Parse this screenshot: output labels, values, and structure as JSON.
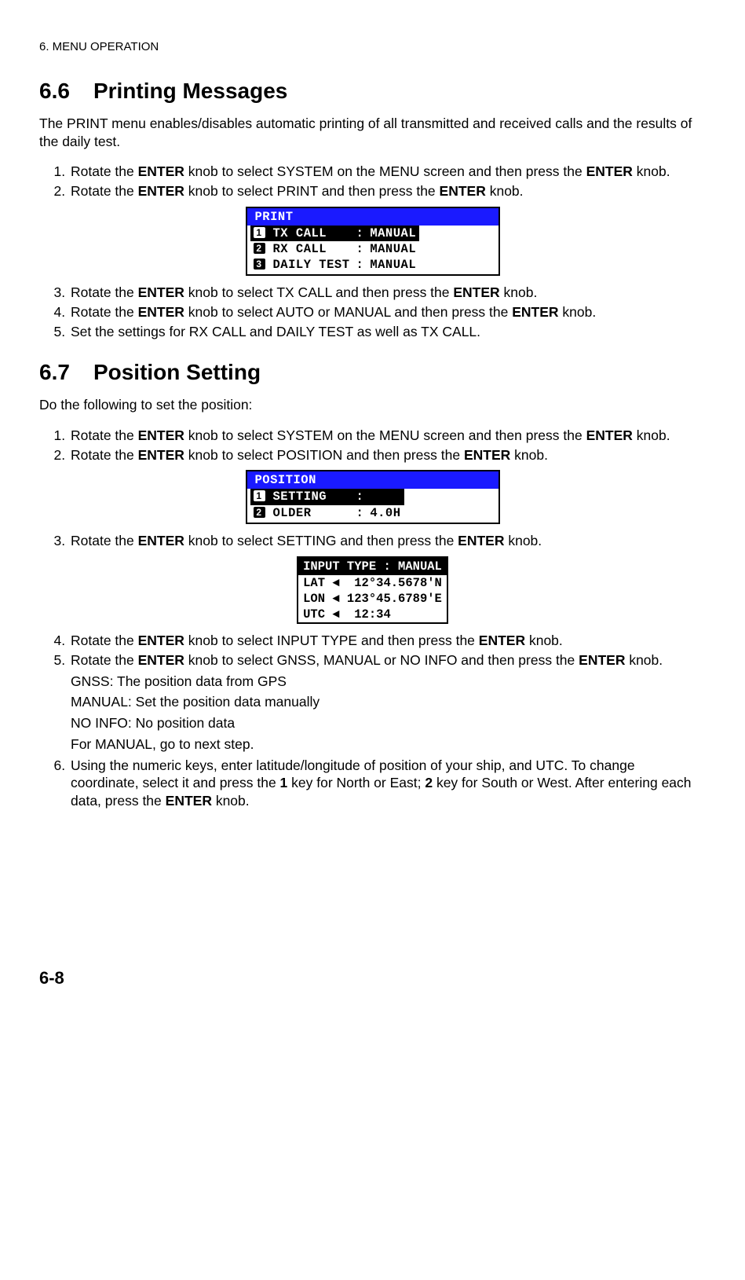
{
  "header": "6. MENU OPERATION",
  "sec66": {
    "num": "6.6",
    "title": "Printing Messages",
    "intro": "The PRINT menu enables/disables automatic printing of all transmitted and received calls and the results of the daily test.",
    "steps": {
      "s1a": "Rotate the ",
      "s1b": "ENTER",
      "s1c": " knob to select SYSTEM on the MENU screen and then press the ",
      "s1d": "ENTER",
      "s1e": " knob.",
      "s2a": "Rotate the ",
      "s2b": "ENTER",
      "s2c": " knob to select PRINT and then press the ",
      "s2d": "ENTER",
      "s2e": " knob.",
      "s3a": "Rotate the ",
      "s3b": "ENTER",
      "s3c": " knob to select TX CALL and then press the ",
      "s3d": "ENTER",
      "s3e": " knob.",
      "s4a": "Rotate the ",
      "s4b": "ENTER",
      "s4c": " knob to select AUTO or MANUAL and then press the ",
      "s4d": "ENTER",
      "s4e": " knob.",
      "s5": "Set the settings for RX CALL and DAILY TEST as well as TX CALL."
    },
    "lcd": {
      "title": "PRINT",
      "rows": [
        {
          "n": "1",
          "label": "TX CALL   ",
          "val": "MANUAL",
          "sel": true
        },
        {
          "n": "2",
          "label": "RX CALL   ",
          "val": "MANUAL",
          "sel": false
        },
        {
          "n": "3",
          "label": "DAILY TEST",
          "val": "MANUAL",
          "sel": false
        }
      ]
    }
  },
  "sec67": {
    "num": "6.7",
    "title": "Position Setting",
    "intro": "Do the following to set the position:",
    "steps": {
      "s1a": "Rotate the ",
      "s1b": "ENTER",
      "s1c": " knob to select SYSTEM on the MENU screen and then press the ",
      "s1d": "ENTER",
      "s1e": " knob.",
      "s2a": "Rotate the ",
      "s2b": "ENTER",
      "s2c": " knob to select POSITION and then press the ",
      "s2d": "ENTER",
      "s2e": " knob.",
      "s3a": "Rotate the ",
      "s3b": "ENTER",
      "s3c": " knob to select SETTING and then press the ",
      "s3d": "ENTER",
      "s3e": " knob.",
      "s4a": "Rotate the ",
      "s4b": "ENTER",
      "s4c": " knob to select INPUT TYPE and then press the ",
      "s4d": "ENTER",
      "s4e": " knob.",
      "s5a": "Rotate the ",
      "s5b": "ENTER",
      "s5c": " knob to select GNSS, MANUAL or NO INFO and then press the ",
      "s5d": "ENTER",
      "s5e": " knob.",
      "sub1": "GNSS: The position data from GPS",
      "sub2": "MANUAL: Set the position data manually",
      "sub3": "NO INFO: No position data",
      "sub4": "For MANUAL, go to next step.",
      "s6a": "Using the numeric keys, enter latitude/longitude of position of your ship, and UTC. To change coordinate, select it and press the ",
      "s6b": "1",
      "s6c": " key for North or East; ",
      "s6d": "2",
      "s6e": " key for South or West. After entering each data, press the ",
      "s6f": "ENTER",
      "s6g": " knob."
    },
    "lcd1": {
      "title": "POSITION",
      "rows": [
        {
          "n": "1",
          "label": "SETTING   ",
          "val": "",
          "sel": true
        },
        {
          "n": "2",
          "label": "OLDER     ",
          "val": "4.0H",
          "sel": false
        }
      ]
    },
    "lcd2": {
      "head": "INPUT TYPE : MANUAL",
      "r1": "LAT ◄  12°34.5678'N",
      "r2": "LON ◄ 123°45.6789'E",
      "r3": "UTC ◄  12:34"
    }
  },
  "pagenum": "6-8"
}
